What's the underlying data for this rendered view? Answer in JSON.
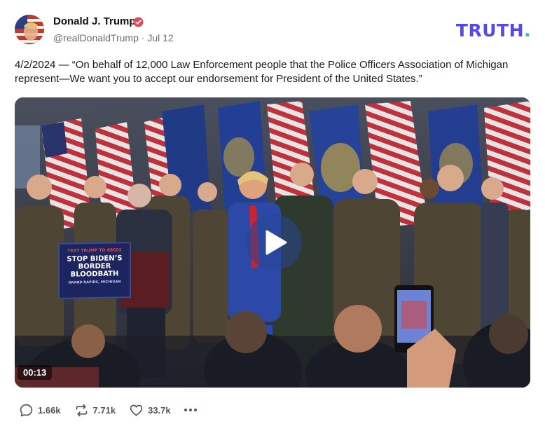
{
  "author": {
    "name": "Donald J. Trump",
    "handle": "@realDonaldTrump",
    "separator": "·",
    "date": "Jul 12",
    "verified_color": "#e64a5a"
  },
  "brand": {
    "text": "TRUTH",
    "dot": ".",
    "color": "#5448ee",
    "dot_color": "#27c3d1"
  },
  "post": {
    "text": "4/2/2024 — “On behalf of 12,000 Law Enforcement people that the Police Officers Association of Michigan represent—We want you to accept our endorsement for President of the United States.”"
  },
  "media": {
    "duration": "00:13",
    "sign": {
      "top": "TEXT TRUMP TO 88022",
      "main": "STOP BIDEN’S BORDER BLOODBATH",
      "sub": "GRAND RAPIDS, MICHIGAN"
    }
  },
  "actions": {
    "replies": "1.66k",
    "retruths": "7.71k",
    "likes": "33.7k",
    "replies_icon": "reply-icon",
    "retruths_icon": "retruth-icon",
    "likes_icon": "heart-icon",
    "more_icon": "more-icon"
  }
}
